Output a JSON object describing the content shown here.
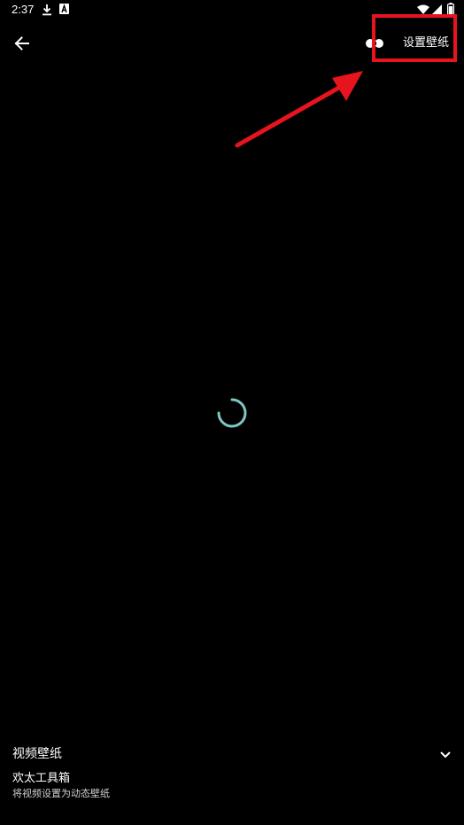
{
  "status_bar": {
    "time": "2:37",
    "icons": [
      "download-icon",
      "a-badge-icon",
      "wifi-icon",
      "signal-icon",
      "battery-icon"
    ]
  },
  "toolbar": {
    "back_icon": "arrow-left-icon",
    "settings_icon": "settings-icon",
    "set_wallpaper_label": "设置壁纸"
  },
  "annotation": {
    "highlight_color": "#e8141d",
    "arrow_color": "#e8141d"
  },
  "content": {
    "spinner_color": "#7ec7c2",
    "background_color": "#000000"
  },
  "bottom_panel": {
    "title": "视频壁纸",
    "app_name": "欢太工具箱",
    "description": "将视频设置为动态壁纸",
    "expand_icon": "chevron-down-icon"
  }
}
